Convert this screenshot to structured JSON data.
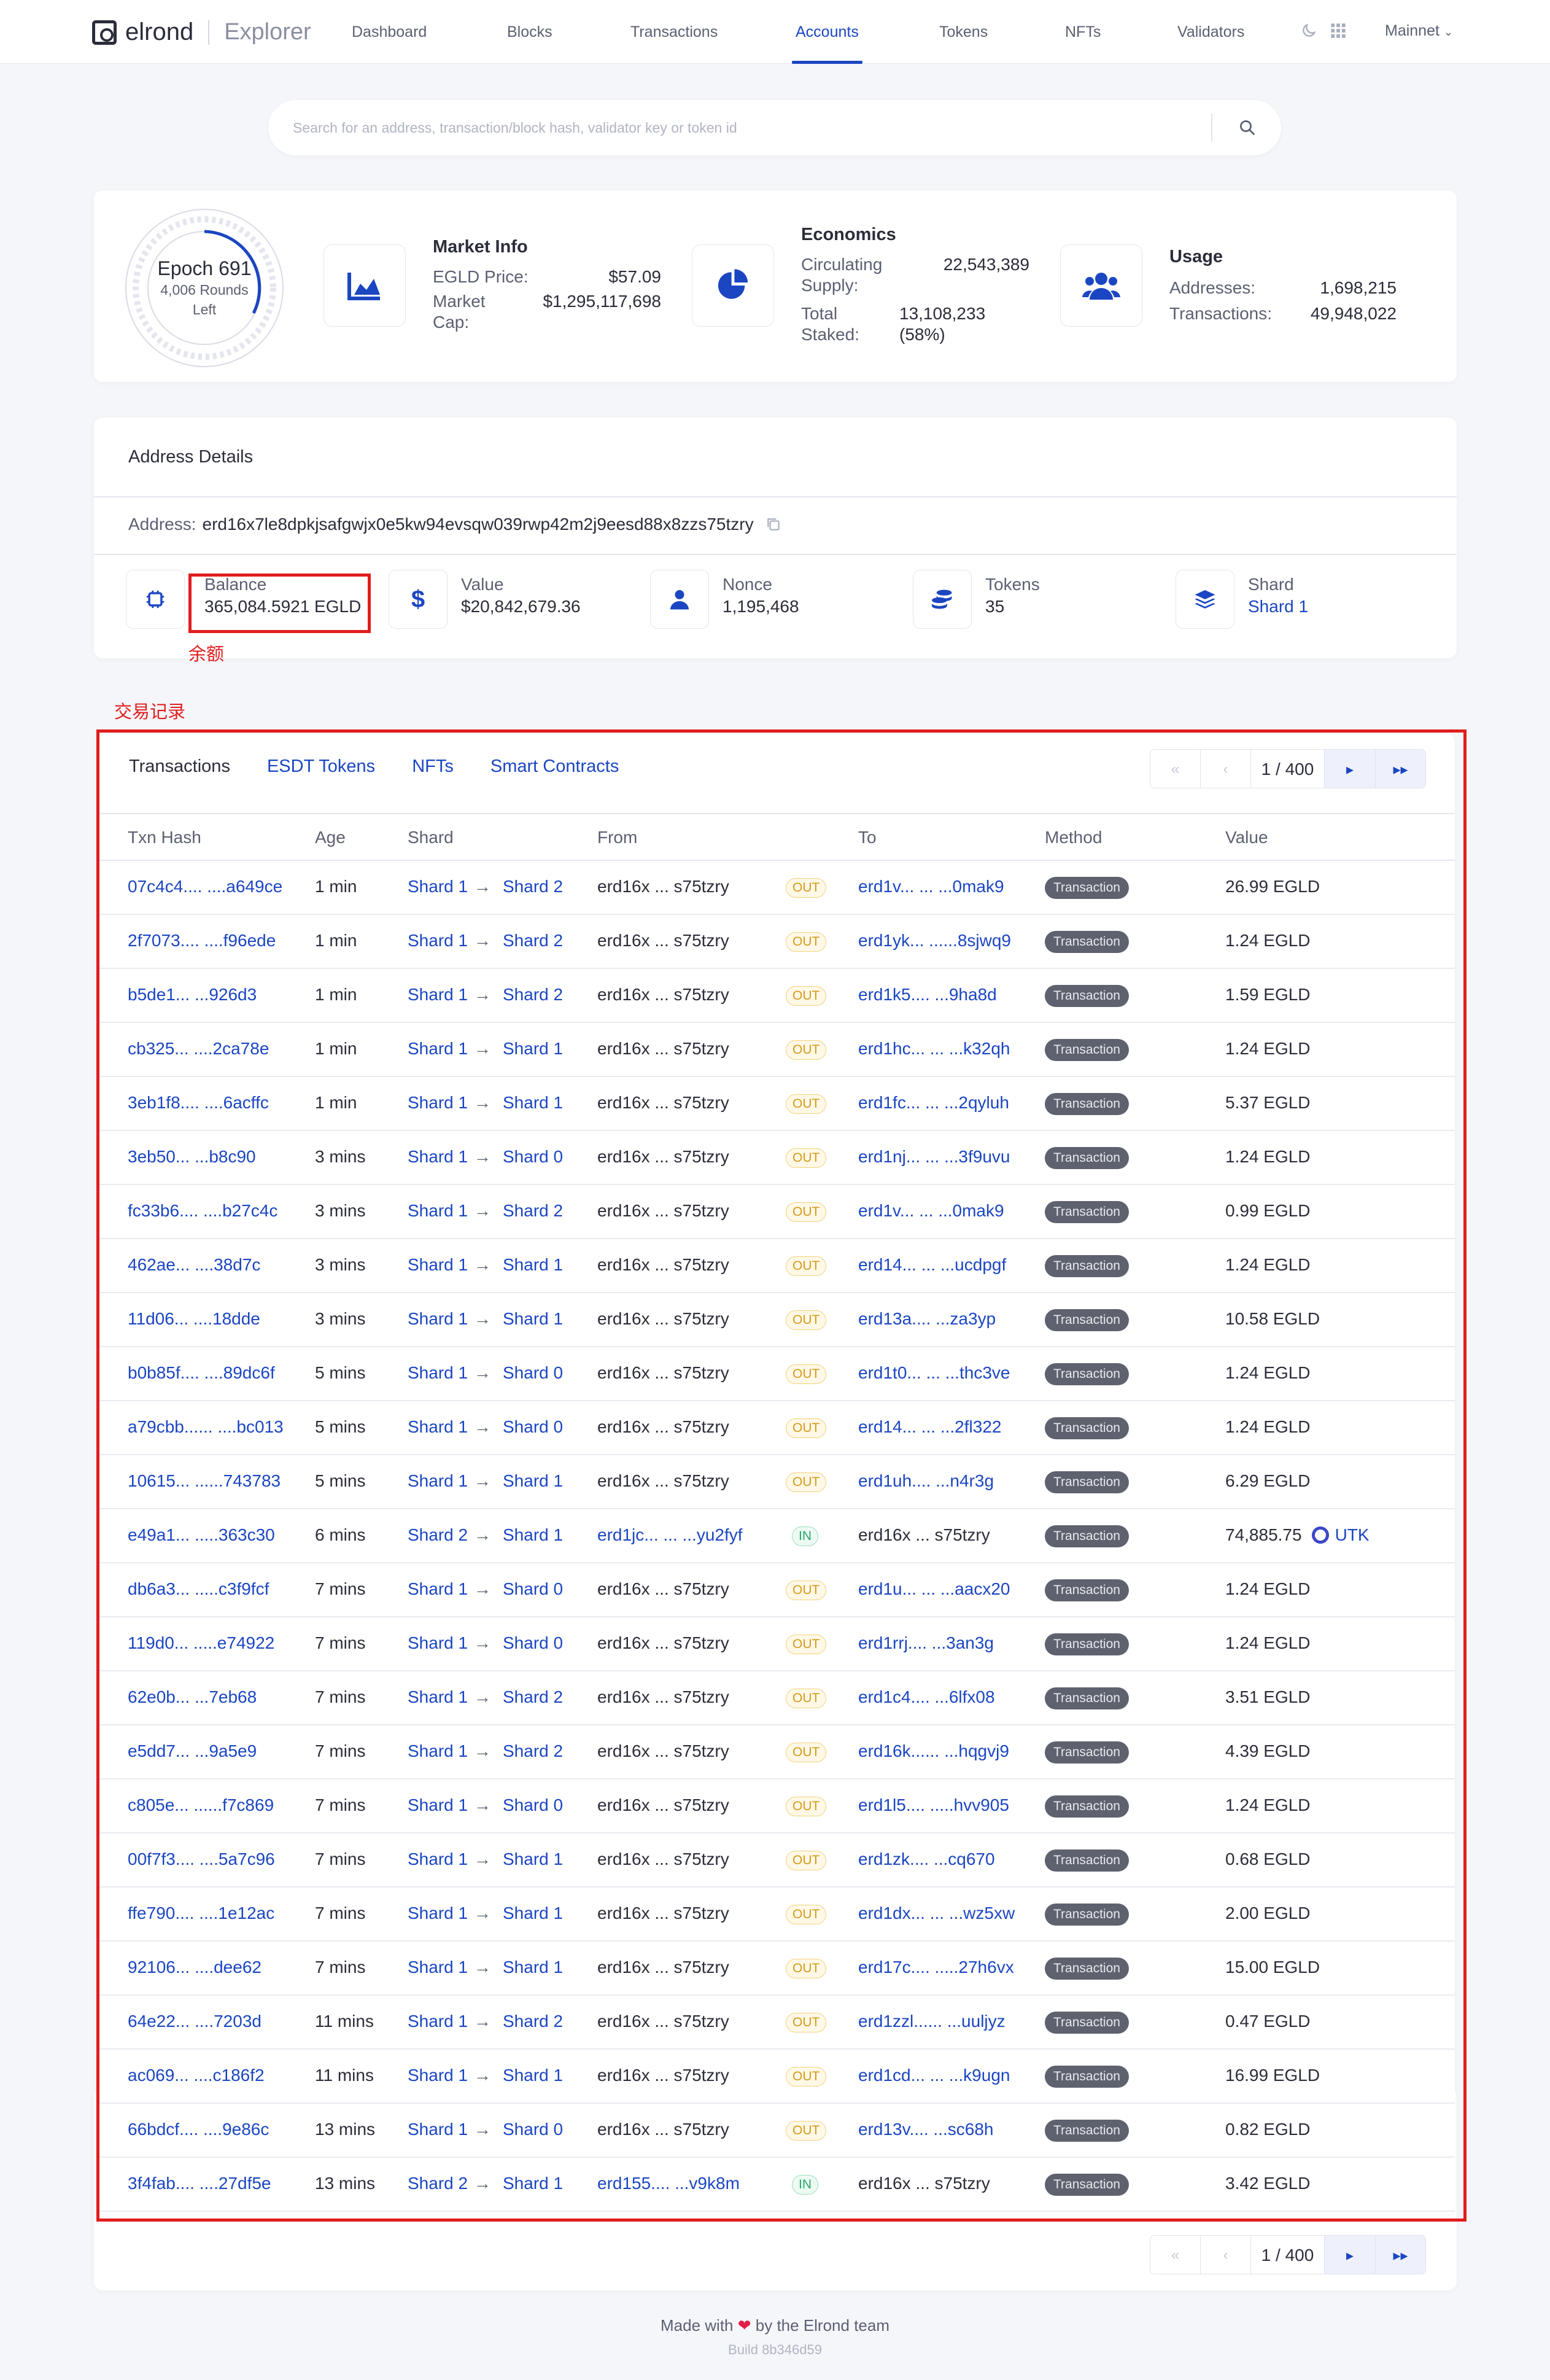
{
  "brand": {
    "name": "elrond",
    "product": "Explorer"
  },
  "nav": [
    {
      "label": "Dashboard",
      "active": false
    },
    {
      "label": "Blocks",
      "active": false
    },
    {
      "label": "Transactions",
      "active": false
    },
    {
      "label": "Accounts",
      "active": true
    },
    {
      "label": "Tokens",
      "active": false
    },
    {
      "label": "NFTs",
      "active": false
    },
    {
      "label": "Validators",
      "active": false
    }
  ],
  "network": "Mainnet",
  "search": {
    "placeholder": "Search for an address, transaction/block hash, validator key or token id"
  },
  "epoch": {
    "title": "Epoch 691",
    "rounds": "4,006 Rounds",
    "left": "Left"
  },
  "market": {
    "title": "Market Info",
    "price_label": "EGLD Price:",
    "price": "$57.09",
    "cap_label1": "Market",
    "cap_label2": "Cap:",
    "cap": "$1,295,117,698"
  },
  "economics": {
    "title": "Economics",
    "supply_label1": "Circulating",
    "supply_label2": "Supply:",
    "supply": "22,543,389",
    "staked_label1": "Total",
    "staked_label2": "Staked:",
    "staked": "13,108,233",
    "staked_pct": "(58%)"
  },
  "usage": {
    "title": "Usage",
    "addresses_label": "Addresses:",
    "addresses": "1,698,215",
    "tx_label": "Transactions:",
    "transactions": "49,948,022"
  },
  "address_details": {
    "header": "Address Details",
    "address_label": "Address:",
    "address": "erd16x7le8dpkjsafgwjx0e5kw94evsqw039rwp42m2j9eesd88x8zzs75tzry",
    "balance_label": "Balance",
    "balance": "365,084.5921 EGLD",
    "value_label": "Value",
    "value": "$20,842,679.36",
    "nonce_label": "Nonce",
    "nonce": "1,195,468",
    "tokens_label": "Tokens",
    "tokens": "35",
    "shard_label": "Shard",
    "shard": "Shard 1"
  },
  "annotations": {
    "balance_note": "余额",
    "tx_note": "交易记录"
  },
  "tabs": [
    "Transactions",
    "ESDT Tokens",
    "NFTs",
    "Smart Contracts"
  ],
  "pager": {
    "page": "1 / 400"
  },
  "columns": [
    "Txn Hash",
    "Age",
    "Shard",
    "From",
    "To",
    "Method",
    "Value"
  ],
  "rows": [
    {
      "hash": "07c4c4.... ....a649ce",
      "age": "1 min",
      "s_from": "Shard 1",
      "s_to": "Shard 2",
      "from": "erd16x    ...  s75tzry",
      "dir": "OUT",
      "to": "erd1v...  ... ...0mak9",
      "method": "Transaction",
      "value": "26.99 EGLD"
    },
    {
      "hash": "2f7073.... ....f96ede",
      "age": "1 min",
      "s_from": "Shard 1",
      "s_to": "Shard 2",
      "from": "erd16x    ...  s75tzry",
      "dir": "OUT",
      "to": "erd1yk... ......8sjwq9",
      "method": "Transaction",
      "value": "1.24 EGLD"
    },
    {
      "hash": "b5de1...   ...926d3",
      "age": "1 min",
      "s_from": "Shard 1",
      "s_to": "Shard 2",
      "from": "erd16x    ...  s75tzry",
      "dir": "OUT",
      "to": "erd1k5....  ...9ha8d",
      "method": "Transaction",
      "value": "1.59 EGLD"
    },
    {
      "hash": "cb325...  ....2ca78e",
      "age": "1 min",
      "s_from": "Shard 1",
      "s_to": "Shard 1",
      "from": "erd16x    ...  s75tzry",
      "dir": "OUT",
      "to": "erd1hc... ...  ...k32qh",
      "method": "Transaction",
      "value": "1.24 EGLD"
    },
    {
      "hash": "3eb1f8.... ....6acffc",
      "age": "1 min",
      "s_from": "Shard 1",
      "s_to": "Shard 1",
      "from": "erd16x    ...  s75tzry",
      "dir": "OUT",
      "to": "erd1fc... ...  ...2qyluh",
      "method": "Transaction",
      "value": "5.37 EGLD"
    },
    {
      "hash": "3eb50...   ...b8c90",
      "age": "3 mins",
      "s_from": "Shard 1",
      "s_to": "Shard 0",
      "from": "erd16x    ...  s75tzry",
      "dir": "OUT",
      "to": "erd1nj... ...  ...3f9uvu",
      "method": "Transaction",
      "value": "1.24 EGLD"
    },
    {
      "hash": "fc33b6.... ....b27c4c",
      "age": "3 mins",
      "s_from": "Shard 1",
      "s_to": "Shard 2",
      "from": "erd16x    ...  s75tzry",
      "dir": "OUT",
      "to": "erd1v...  ... ...0mak9",
      "method": "Transaction",
      "value": "0.99 EGLD"
    },
    {
      "hash": "462ae...  ....38d7c",
      "age": "3 mins",
      "s_from": "Shard 1",
      "s_to": "Shard 1",
      "from": "erd16x    ...  s75tzry",
      "dir": "OUT",
      "to": "erd14... ... ...ucdpgf",
      "method": "Transaction",
      "value": "1.24 EGLD"
    },
    {
      "hash": "11d06...  ....18dde",
      "age": "3 mins",
      "s_from": "Shard 1",
      "s_to": "Shard 1",
      "from": "erd16x    ...  s75tzry",
      "dir": "OUT",
      "to": "erd13a....   ...za3yp",
      "method": "Transaction",
      "value": "10.58 EGLD"
    },
    {
      "hash": "b0b85f.... ....89dc6f",
      "age": "5 mins",
      "s_from": "Shard 1",
      "s_to": "Shard 0",
      "from": "erd16x    ...  s75tzry",
      "dir": "OUT",
      "to": "erd1t0... ... ...thc3ve",
      "method": "Transaction",
      "value": "1.24 EGLD"
    },
    {
      "hash": "a79cbb...... ....bc013",
      "age": "5 mins",
      "s_from": "Shard 1",
      "s_to": "Shard 0",
      "from": "erd16x    ...  s75tzry",
      "dir": "OUT",
      "to": "erd14... ...  ...2fl322",
      "method": "Transaction",
      "value": "1.24 EGLD"
    },
    {
      "hash": "10615... ......743783",
      "age": "5 mins",
      "s_from": "Shard 1",
      "s_to": "Shard 1",
      "from": "erd16x    ...  s75tzry",
      "dir": "OUT",
      "to": "erd1uh.... ...n4r3g",
      "method": "Transaction",
      "value": "6.29 EGLD"
    },
    {
      "hash": "e49a1... .....363c30",
      "age": "6 mins",
      "s_from": "Shard 2",
      "s_to": "Shard 1",
      "from": "erd1jc... ... ...yu2fyf",
      "dir": "IN",
      "to": "erd16x    ...  s75tzry",
      "method": "Transaction",
      "value": "74,885.75",
      "value_token": "UTK"
    },
    {
      "hash": "db6a3...  .....c3f9fcf",
      "age": "7 mins",
      "s_from": "Shard 1",
      "s_to": "Shard 0",
      "from": "erd16x    ...  s75tzry",
      "dir": "OUT",
      "to": "erd1u... ...  ...aacx20",
      "method": "Transaction",
      "value": "1.24 EGLD"
    },
    {
      "hash": "119d0... .....e74922",
      "age": "7 mins",
      "s_from": "Shard 1",
      "s_to": "Shard 0",
      "from": "erd16x    ...  s75tzry",
      "dir": "OUT",
      "to": "erd1rrj.... ...3an3g",
      "method": "Transaction",
      "value": "1.24 EGLD"
    },
    {
      "hash": "62e0b...   ...7eb68",
      "age": "7 mins",
      "s_from": "Shard 1",
      "s_to": "Shard 2",
      "from": "erd16x    ...  s75tzry",
      "dir": "OUT",
      "to": "erd1c4.... ...6lfx08",
      "method": "Transaction",
      "value": "3.51 EGLD"
    },
    {
      "hash": "e5dd7...   ...9a5e9",
      "age": "7 mins",
      "s_from": "Shard 1",
      "s_to": "Shard 2",
      "from": "erd16x    ...  s75tzry",
      "dir": "OUT",
      "to": "erd16k...... ...hqgvj9",
      "method": "Transaction",
      "value": "4.39 EGLD"
    },
    {
      "hash": "c805e... ......f7c869",
      "age": "7 mins",
      "s_from": "Shard 1",
      "s_to": "Shard 0",
      "from": "erd16x    ...  s75tzry",
      "dir": "OUT",
      "to": "erd1l5.... .....hvv905",
      "method": "Transaction",
      "value": "1.24 EGLD"
    },
    {
      "hash": "00f7f3.... ....5a7c96",
      "age": "7 mins",
      "s_from": "Shard 1",
      "s_to": "Shard 1",
      "from": "erd16x    ...  s75tzry",
      "dir": "OUT",
      "to": "erd1zk.... ...cq670",
      "method": "Transaction",
      "value": "0.68 EGLD"
    },
    {
      "hash": "ffe790.... ....1e12ac",
      "age": "7 mins",
      "s_from": "Shard 1",
      "s_to": "Shard 1",
      "from": "erd16x    ...  s75tzry",
      "dir": "OUT",
      "to": "erd1dx... ... ...wz5xw",
      "method": "Transaction",
      "value": "2.00 EGLD"
    },
    {
      "hash": "92106...  ....dee62",
      "age": "7 mins",
      "s_from": "Shard 1",
      "s_to": "Shard 1",
      "from": "erd16x    ...  s75tzry",
      "dir": "OUT",
      "to": "erd17c.... .....27h6vx",
      "method": "Transaction",
      "value": "15.00 EGLD"
    },
    {
      "hash": "64e22...  ....7203d",
      "age": "11 mins",
      "s_from": "Shard 1",
      "s_to": "Shard 2",
      "from": "erd16x    ...  s75tzry",
      "dir": "OUT",
      "to": "erd1zzl......  ...uuljyz",
      "method": "Transaction",
      "value": "0.47 EGLD"
    },
    {
      "hash": "ac069... ....c186f2",
      "age": "11 mins",
      "s_from": "Shard 1",
      "s_to": "Shard 1",
      "from": "erd16x    ...  s75tzry",
      "dir": "OUT",
      "to": "erd1cd... ...  ...k9ugn",
      "method": "Transaction",
      "value": "16.99 EGLD"
    },
    {
      "hash": "66bdcf.... ....9e86c",
      "age": "13 mins",
      "s_from": "Shard 1",
      "s_to": "Shard 0",
      "from": "erd16x    ...  s75tzry",
      "dir": "OUT",
      "to": "erd13v.... ...sc68h",
      "method": "Transaction",
      "value": "0.82 EGLD"
    },
    {
      "hash": "3f4fab.... ....27df5e",
      "age": "13 mins",
      "s_from": "Shard 2",
      "s_to": "Shard 1",
      "from": "erd155.... ...v9k8m",
      "dir": "IN",
      "to": "erd16x    ...  s75tzry",
      "method": "Transaction",
      "value": "3.42 EGLD"
    }
  ],
  "footer": {
    "made_with": "Made with",
    "by": "by the Elrond team",
    "build": "Build 8b346d59"
  },
  "colors": {
    "accent": "#1b46c2",
    "annotation": "#e11d1d",
    "out": "#d49a1a",
    "in": "#2aa86a"
  }
}
